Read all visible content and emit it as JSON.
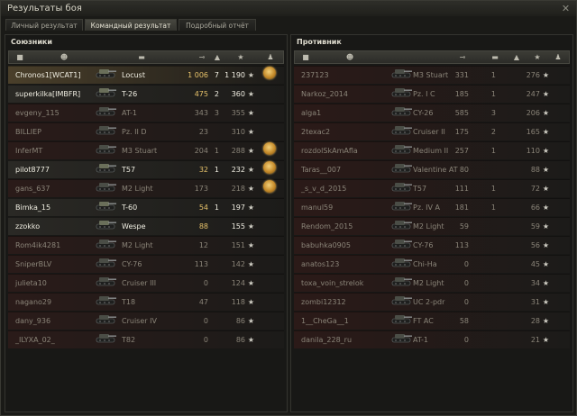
{
  "window": {
    "title": "Результаты боя",
    "close_glyph": "✕"
  },
  "tabs": [
    {
      "label": "Личный результат",
      "active": false
    },
    {
      "label": "Командный результат",
      "active": true
    },
    {
      "label": "Подробный отчёт",
      "active": false
    }
  ],
  "allies": {
    "title": "Союзники",
    "rows": [
      {
        "player": "Chronos1[WCAT1]",
        "tank": "Locust",
        "damage": "1 006",
        "kills": "7",
        "xp": "1 190",
        "medal": true,
        "alive": true,
        "self": true
      },
      {
        "player": "superkilka[IMBFR]",
        "tank": "T-26",
        "damage": "475",
        "kills": "2",
        "xp": "360",
        "medal": false,
        "alive": true
      },
      {
        "player": "evgeny_115",
        "tank": "AT-1",
        "damage": "343",
        "kills": "3",
        "xp": "355",
        "medal": false,
        "alive": false
      },
      {
        "player": "BILLIEP",
        "tank": "Pz. II D",
        "damage": "23",
        "kills": "",
        "xp": "310",
        "medal": false,
        "alive": false
      },
      {
        "player": "InferMT",
        "tank": "M3 Stuart",
        "damage": "204",
        "kills": "1",
        "xp": "288",
        "medal": true,
        "alive": false
      },
      {
        "player": "pilot8777",
        "tank": "T57",
        "damage": "32",
        "kills": "1",
        "xp": "232",
        "medal": true,
        "alive": true
      },
      {
        "player": "gans_637",
        "tank": "M2 Light",
        "damage": "173",
        "kills": "",
        "xp": "218",
        "medal": true,
        "alive": false
      },
      {
        "player": "Bimka_15",
        "tank": "T-60",
        "damage": "54",
        "kills": "1",
        "xp": "197",
        "medal": false,
        "alive": true
      },
      {
        "player": "zzokko",
        "tank": "Wespe",
        "damage": "88",
        "kills": "",
        "xp": "155",
        "medal": false,
        "alive": true
      },
      {
        "player": "Rom4ik4281",
        "tank": "M2 Light",
        "damage": "12",
        "kills": "",
        "xp": "151",
        "medal": false,
        "alive": false
      },
      {
        "player": "SniperBLV",
        "tank": "CY-76",
        "damage": "113",
        "kills": "",
        "xp": "142",
        "medal": false,
        "alive": false
      },
      {
        "player": "julieta10",
        "tank": "Cruiser III",
        "damage": "0",
        "kills": "",
        "xp": "124",
        "medal": false,
        "alive": false
      },
      {
        "player": "nagano29",
        "tank": "T18",
        "damage": "47",
        "kills": "",
        "xp": "118",
        "medal": false,
        "alive": false
      },
      {
        "player": "dany_936",
        "tank": "Cruiser IV",
        "damage": "0",
        "kills": "",
        "xp": "86",
        "medal": false,
        "alive": false
      },
      {
        "player": "_ILYXA_02_",
        "tank": "T82",
        "damage": "0",
        "kills": "",
        "xp": "86",
        "medal": false,
        "alive": false
      }
    ]
  },
  "enemies": {
    "title": "Противник",
    "rows": [
      {
        "player": "237123",
        "tank": "M3 Stuart",
        "damage": "331",
        "kills": "1",
        "xp": "276"
      },
      {
        "player": "Narkoz_2014",
        "tank": "Pz. I C",
        "damage": "185",
        "kills": "1",
        "xp": "247"
      },
      {
        "player": "alga1",
        "tank": "CY-26",
        "damage": "585",
        "kills": "3",
        "xp": "206"
      },
      {
        "player": "2texac2",
        "tank": "Cruiser II",
        "damage": "175",
        "kills": "2",
        "xp": "165"
      },
      {
        "player": "rozdolSkAmAfla",
        "tank": "Medium II",
        "damage": "257",
        "kills": "1",
        "xp": "110"
      },
      {
        "player": "Taras__007",
        "tank": "Valentine AT",
        "damage": "80",
        "kills": "",
        "xp": "88"
      },
      {
        "player": "_s_v_d_2015",
        "tank": "T57",
        "damage": "111",
        "kills": "1",
        "xp": "72"
      },
      {
        "player": "manul59",
        "tank": "Pz. IV A",
        "damage": "181",
        "kills": "1",
        "xp": "66"
      },
      {
        "player": "Rendom_2015",
        "tank": "M2 Light",
        "damage": "59",
        "kills": "",
        "xp": "59"
      },
      {
        "player": "babuhka0905",
        "tank": "CY-76",
        "damage": "113",
        "kills": "",
        "xp": "56"
      },
      {
        "player": "anatos123",
        "tank": "Chi-Ha",
        "damage": "0",
        "kills": "",
        "xp": "45"
      },
      {
        "player": "toxa_voin_strelok",
        "tank": "M2 Light",
        "damage": "0",
        "kills": "",
        "xp": "34"
      },
      {
        "player": "zombi12312",
        "tank": "UC 2-pdr",
        "damage": "0",
        "kills": "",
        "xp": "31"
      },
      {
        "player": "1__CheGa__1",
        "tank": "FT AC",
        "damage": "58",
        "kills": "",
        "xp": "28"
      },
      {
        "player": "danila_228_ru",
        "tank": "AT-1",
        "damage": "0",
        "kills": "",
        "xp": "21"
      }
    ]
  },
  "icons": {
    "squad": "squad-icon",
    "player": "player-icon",
    "tank": "tank-icon",
    "damage": "damage-icon",
    "kills": "kills-icon",
    "xp": "star-icon",
    "medal": "medal-icon"
  },
  "header_glyphs": {
    "squad": "■",
    "player": "☻",
    "tank": "▬",
    "damage": "⊸",
    "kills": "▲",
    "xp": "★",
    "medal": "♟"
  },
  "colors": {
    "ally_row": "#2a2925",
    "ally_self": "#4a3f2a",
    "ally_dead": "#2a1b19",
    "enemy_row": "#2b1a18",
    "text_alive": "#f0eee2",
    "text_dead": "#8a8478",
    "damage_alive": "#e6c26a"
  }
}
